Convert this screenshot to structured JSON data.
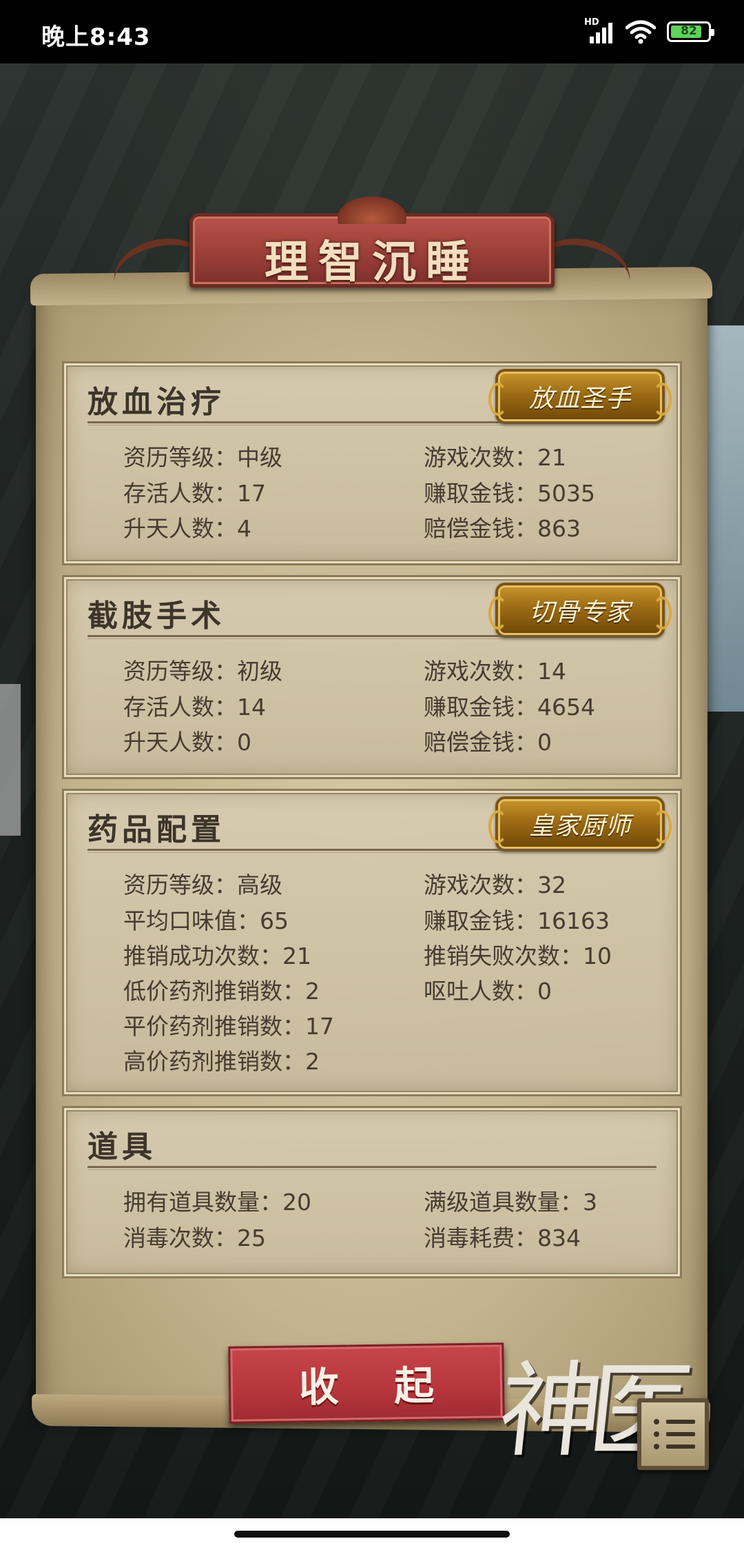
{
  "status_bar": {
    "time": "晚上8:43",
    "network": "HD",
    "battery": "82"
  },
  "title": "理智沉睡",
  "panels": [
    {
      "title": "放血治疗",
      "badge": "放血圣手",
      "stats": [
        {
          "label": "资历等级",
          "value": "中级"
        },
        {
          "label": "游戏次数",
          "value": "21"
        },
        {
          "label": "存活人数",
          "value": "17"
        },
        {
          "label": "赚取金钱",
          "value": "5035"
        },
        {
          "label": "升天人数",
          "value": "4"
        },
        {
          "label": "赔偿金钱",
          "value": "863"
        }
      ]
    },
    {
      "title": "截肢手术",
      "badge": "切骨专家",
      "stats": [
        {
          "label": "资历等级",
          "value": "初级"
        },
        {
          "label": "游戏次数",
          "value": "14"
        },
        {
          "label": "存活人数",
          "value": "14"
        },
        {
          "label": "赚取金钱",
          "value": "4654"
        },
        {
          "label": "升天人数",
          "value": "0"
        },
        {
          "label": "赔偿金钱",
          "value": "0"
        }
      ]
    },
    {
      "title": "药品配置",
      "badge": "皇家厨师",
      "stats": [
        {
          "label": "资历等级",
          "value": "高级"
        },
        {
          "label": "游戏次数",
          "value": "32"
        },
        {
          "label": "平均口味值",
          "value": "65"
        },
        {
          "label": "赚取金钱",
          "value": "16163"
        },
        {
          "label": "推销成功次数",
          "value": "21"
        },
        {
          "label": "推销失败次数",
          "value": "10"
        },
        {
          "label": "低价药剂推销数",
          "value": "2"
        },
        {
          "label": "呕吐人数",
          "value": "0"
        },
        {
          "label": "平价药剂推销数",
          "value": "17"
        },
        {
          "label": "高价药剂推销数",
          "value": "2"
        }
      ]
    },
    {
      "title": "道具",
      "stats": [
        {
          "label": "拥有道具数量",
          "value": "20"
        },
        {
          "label": "满级道具数量",
          "value": "3"
        },
        {
          "label": "消毒次数",
          "value": "25"
        },
        {
          "label": "消毒耗费",
          "value": "834"
        }
      ]
    }
  ],
  "collapse_button": "收 起",
  "logo_text": "神医",
  "icons": {
    "menu": "list-menu-icon",
    "wifi": "wifi-icon",
    "signal": "signal-icon",
    "battery": "battery-icon"
  },
  "colors": {
    "banner": "#a5443d",
    "badge_gold": "#b7851f",
    "collapse_button": "#b9383e",
    "paper": "#c9b995",
    "text": "#463c30"
  }
}
